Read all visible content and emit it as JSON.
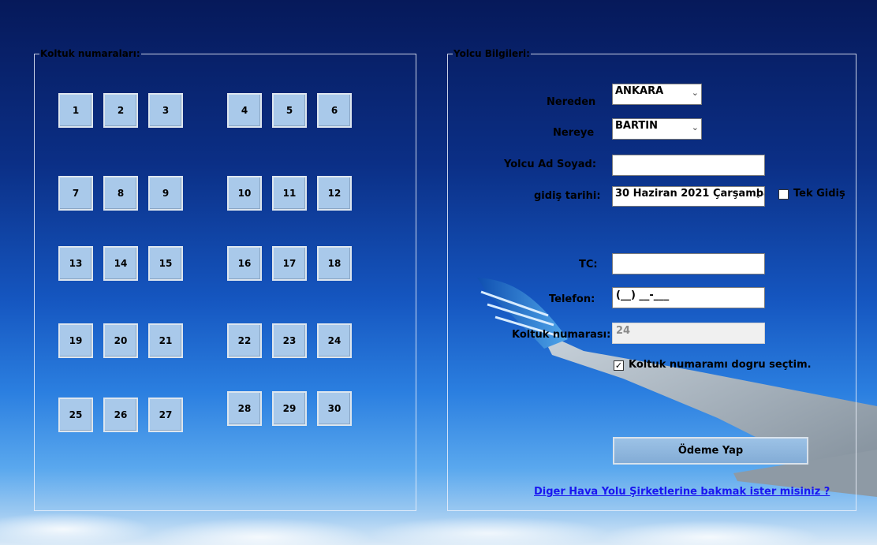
{
  "seat_panel": {
    "title": "Koltuk numaraları:",
    "seats": [
      "1",
      "2",
      "3",
      "4",
      "5",
      "6",
      "7",
      "8",
      "9",
      "10",
      "11",
      "12",
      "13",
      "14",
      "15",
      "16",
      "17",
      "18",
      "19",
      "20",
      "21",
      "22",
      "23",
      "24",
      "25",
      "26",
      "27",
      "28",
      "29",
      "30"
    ]
  },
  "passenger_panel": {
    "title": "Yolcu Bilgileri:",
    "from_label": "Nereden",
    "from_value": "ANKARA",
    "to_label": "Nereye",
    "to_value": "BARTIN",
    "name_label": "Yolcu Ad Soyad:",
    "name_value": "",
    "date_label": "gidiş tarihi:",
    "date_value": "30  Haziran  2021 Çarşamba",
    "one_way_label": "Tek Gidiş",
    "one_way_checked": false,
    "tc_label": "TC:",
    "tc_value": "",
    "phone_label": "Telefon:",
    "phone_value": "(__) __-___",
    "seat_no_label": "Koltuk numarası:",
    "seat_no_value": "24",
    "confirm_label": "Koltuk numaramı dogru seçtim.",
    "confirm_checked": true,
    "pay_button": "Ödeme Yap",
    "other_airlines_link": "Diger Hava Yolu Şirketlerine bakmak ister misiniz ?"
  },
  "icons": {
    "dropdown": "chevron-down-icon",
    "check": "checkmark-icon"
  },
  "colors": {
    "seat_fill": "#a9c9ea",
    "link": "#1a16f0"
  }
}
